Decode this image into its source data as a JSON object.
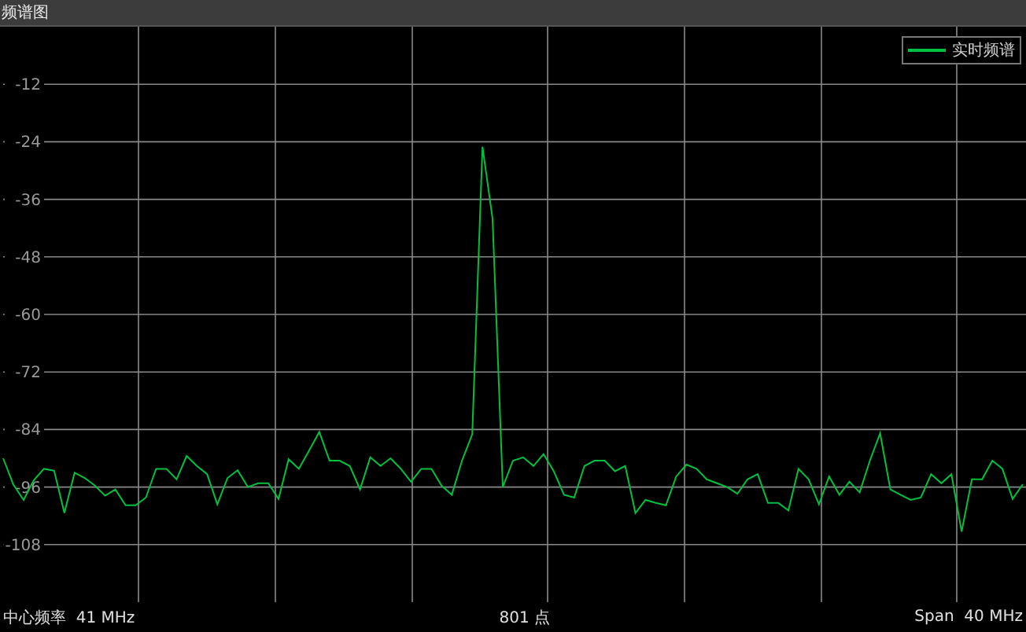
{
  "window": {
    "title": "频谱图"
  },
  "chart_data": {
    "type": "line",
    "ylim": [
      -120,
      0
    ],
    "yticks": [
      -12,
      -24,
      -36,
      -48,
      -60,
      -72,
      -84,
      -96,
      -108
    ],
    "grid": true,
    "series": [
      {
        "name": "实时频谱",
        "color": "#00c040",
        "values": [
          -90,
          -95.5,
          -98.7,
          -94.6,
          -92.2,
          -92.6,
          -101.4,
          -93,
          -94.1,
          -95.7,
          -97.8,
          -96.5,
          -99.8,
          -99.8,
          -98.2,
          -92.2,
          -92.2,
          -94.4,
          -89.5,
          -91.6,
          -93.3,
          -99.6,
          -94.1,
          -92.5,
          -96,
          -95.2,
          -95.2,
          -98.5,
          -90.2,
          -92.2,
          -88.4,
          -84.5,
          -90.5,
          -90.5,
          -91.6,
          -96.5,
          -89.8,
          -91.6,
          -90,
          -92.2,
          -94.9,
          -92.2,
          -92.2,
          -95.7,
          -97.6,
          -90.5,
          -85,
          -25,
          -40,
          -96,
          -90.5,
          -89.8,
          -91.6,
          -89.1,
          -92.7,
          -97.6,
          -98.2,
          -91.6,
          -90.5,
          -90.5,
          -92.7,
          -91.6,
          -101.4,
          -98.7,
          -99.3,
          -99.8,
          -93.8,
          -91.3,
          -92.2,
          -94.4,
          -95.2,
          -96,
          -97.4,
          -94.4,
          -93.3,
          -99.3,
          -99.3,
          -100.9,
          -92.2,
          -94.4,
          -99.6,
          -93.8,
          -97.6,
          -94.9,
          -97.1,
          -90.5,
          -84.8,
          -96.5,
          -97.6,
          -98.7,
          -98.2,
          -93.3,
          -95.2,
          -93.3,
          -105.3,
          -94.4,
          -94.4,
          -90.5,
          -92.2,
          -98.5,
          -95.4
        ]
      }
    ]
  },
  "status_bar": {
    "center_frequency": "中心频率  41 MHz",
    "points": "801 点",
    "span": "Span  40 MHz"
  }
}
